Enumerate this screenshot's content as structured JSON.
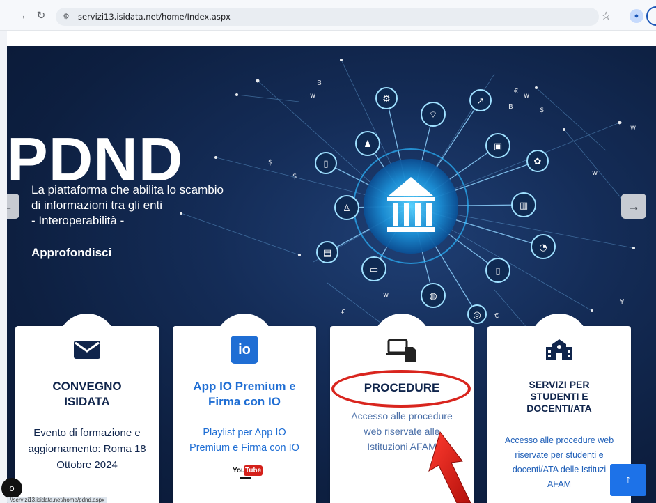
{
  "browser": {
    "url": "servizi13.isidata.net/home/Index.aspx",
    "status_url": "//servizi13.isidata.net/home/pdnd.aspx"
  },
  "hero": {
    "title": "PDND",
    "line1": "La piattaforma che abilita lo scambio",
    "line2": "di informazioni tra gli enti",
    "line3": "- Interoperabilità -",
    "link": "Approfondisci"
  },
  "cards": [
    {
      "title_line1": "CONVEGNO",
      "title_line2": "ISIDATA",
      "text_line1": "Evento di formazione e",
      "text_line2": "aggiornamento: Roma 18",
      "text_line3": "Ottobre 2024"
    },
    {
      "title_line1": "App IO Premium e",
      "title_line2": "Firma con IO",
      "text_line1": "Playlist per App IO",
      "text_line2": "Premium e Firma con IO",
      "yt_you": "You",
      "yt_tube": "Tube",
      "icon_text": "io"
    },
    {
      "title_line1": "PROCEDURE",
      "text_line1": "Accesso alle procedure",
      "text_line2": "web riservate alle",
      "text_line3": "Istituzioni AFAM"
    },
    {
      "title_line1": "SERVIZI PER",
      "title_line2": "STUDENTI E",
      "title_line3": "DOCENTI/ATA",
      "text_line1": "Accesso alle procedure web",
      "text_line2": "riservate per studenti e",
      "text_line3": "docenti/ATA delle Istituzi",
      "text_line4": "AFAM"
    }
  ],
  "colors": {
    "navy": "#10254c",
    "blue": "#1f6ed4",
    "annotation_red": "#d9251e",
    "hero_bg": "#142c57"
  },
  "icons": {
    "back": "arrow-right-icon",
    "reload": "reload-icon",
    "envelope": "envelope-icon",
    "devices": "devices-icon",
    "school": "school-icon"
  }
}
